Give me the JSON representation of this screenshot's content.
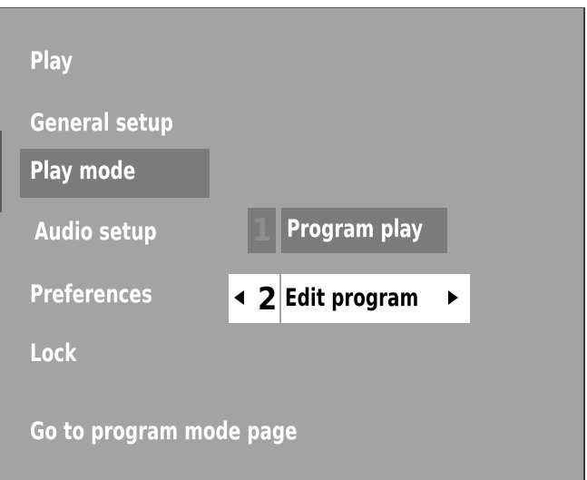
{
  "menu": {
    "items": [
      {
        "label": "Play"
      },
      {
        "label": "General setup"
      },
      {
        "label": "Play mode"
      },
      {
        "label": "Audio setup"
      },
      {
        "label": "Preferences"
      },
      {
        "label": "Lock"
      }
    ],
    "selected": "Play mode"
  },
  "submenu": {
    "options": [
      {
        "number": "1",
        "label": "Program play"
      },
      {
        "number": "2",
        "label": "Edit program"
      }
    ],
    "focused": "Edit program"
  },
  "hint": "Go to program mode page",
  "colors": {
    "background": "#a3a3a3",
    "highlight": "#7b7b7b",
    "focus_background": "#ffffff",
    "text": "#ffffff",
    "focus_text": "#000000"
  },
  "icons": {
    "left_arrow": "arrow-left-icon",
    "right_arrow": "arrow-right-icon"
  }
}
